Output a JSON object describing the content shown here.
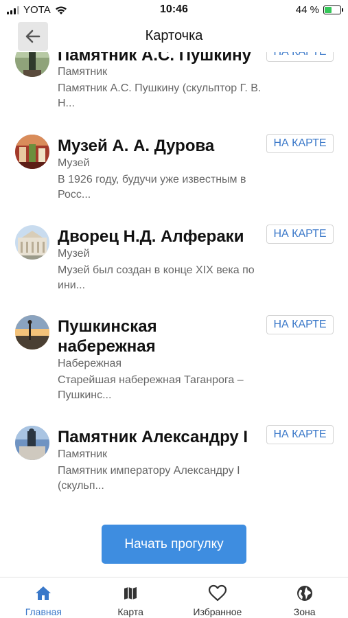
{
  "status_bar": {
    "carrier": "YOTA",
    "time": "10:46",
    "battery": "44 %",
    "battery_level": 0.44
  },
  "header": {
    "title": "Карточка"
  },
  "places": [
    {
      "title": "Памятник  А.С. Пушкину",
      "category": "Памятник",
      "description": "Памятник А.С. Пушкину (скульптор Г. В. Н...",
      "button": "НА КАРТЕ"
    },
    {
      "title": "Музей А. А. Дурова",
      "category": "Музей",
      "description": "В 1926 году, будучи уже известным в Росс...",
      "button": "НА КАРТЕ"
    },
    {
      "title": "Дворец Н.Д. Алфераки",
      "category": "Музей",
      "description": "Музей был создан в конце XIX века по ини...",
      "button": "НА КАРТЕ"
    },
    {
      "title": "Пушкинская набережная",
      "category": "Набережная",
      "description": "Старейшая набережная Таганрога – Пушкинс...",
      "button": "НА КАРТЕ"
    },
    {
      "title": "Памятник Александру I",
      "category": "Памятник",
      "description": "Памятник императору Александру I (скульп...",
      "button": "НА КАРТЕ"
    }
  ],
  "start_button": "Начать прогулку",
  "tabs": [
    {
      "label": "Главная",
      "icon": "home-icon",
      "active": true
    },
    {
      "label": "Карта",
      "icon": "map-icon",
      "active": false
    },
    {
      "label": "Избранное",
      "icon": "heart-icon",
      "active": false
    },
    {
      "label": "Зона",
      "icon": "globe-icon",
      "active": false
    }
  ],
  "colors": {
    "accent": "#3a78c9",
    "button": "#3e8de0",
    "battery": "#35c759"
  }
}
